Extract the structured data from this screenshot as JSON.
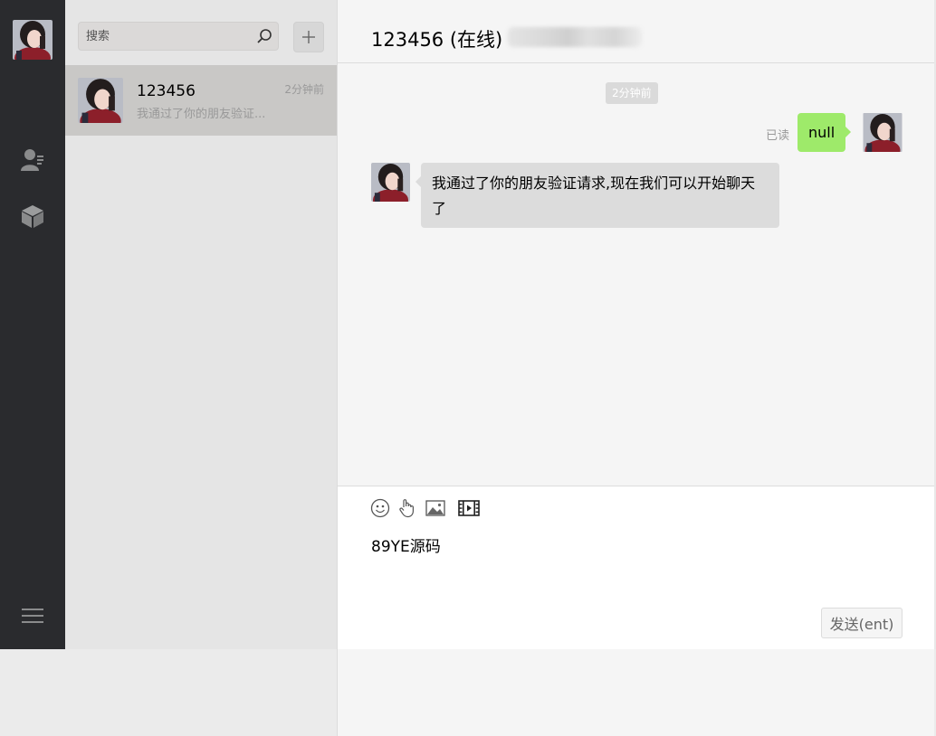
{
  "nav": {
    "icons": [
      "chat-icon",
      "contacts-icon",
      "cube-icon",
      "menu-icon"
    ],
    "active_color": "#1aad19",
    "icon_color": "#8a8b8c"
  },
  "search": {
    "placeholder": "搜索",
    "add_label": "+"
  },
  "conversations": [
    {
      "name": "123456",
      "time": "2分钟前",
      "preview": "我通过了你的朋友验证..."
    }
  ],
  "chat": {
    "title": "123456 (在线)",
    "time_separator": "2分钟前",
    "messages": [
      {
        "side": "right",
        "text": "null",
        "status": "已读"
      },
      {
        "side": "left",
        "text": "我通过了你的朋友验证请求,现在我们可以开始聊天了"
      }
    ],
    "composer": {
      "text": "89YE源码",
      "send_label": "发送(ent)"
    }
  },
  "colors": {
    "sidebar": "#2a2b2e",
    "list_bg": "#e5e5e5",
    "selected_item": "#c9c8c6",
    "chat_bg": "#f5f5f5",
    "bubble_self": "#9eea6a",
    "bubble_other": "#dcdcdc"
  }
}
